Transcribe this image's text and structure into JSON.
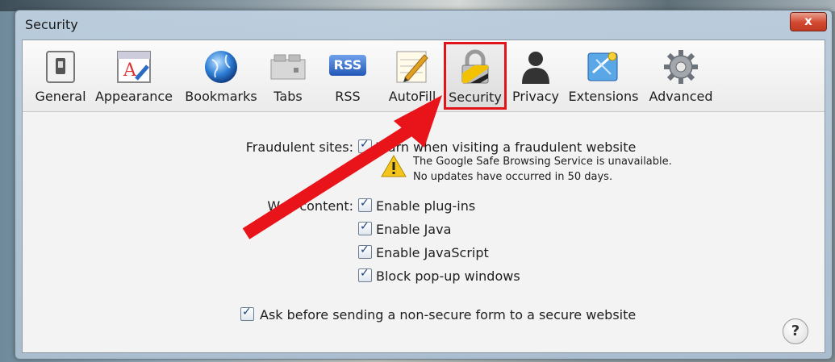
{
  "window": {
    "title": "Security",
    "close_glyph": "x"
  },
  "toolbar": {
    "items": [
      {
        "label": "General",
        "icon": "general-switch-icon"
      },
      {
        "label": "Appearance",
        "icon": "appearance-icon"
      },
      {
        "label": "Bookmarks",
        "icon": "globe-icon"
      },
      {
        "label": "Tabs",
        "icon": "tabs-icon"
      },
      {
        "label": "RSS",
        "icon": "rss-icon",
        "icon_text": "RSS"
      },
      {
        "label": "AutoFill",
        "icon": "autofill-pencil-icon"
      },
      {
        "label": "Security",
        "icon": "padlock-icon",
        "selected": true
      },
      {
        "label": "Privacy",
        "icon": "person-silhouette-icon"
      },
      {
        "label": "Extensions",
        "icon": "puzzle-icon"
      },
      {
        "label": "Advanced",
        "icon": "gear-icon"
      }
    ]
  },
  "fraud": {
    "label": "Fraudulent sites:",
    "checkbox_text": "Warn when visiting a fraudulent website",
    "checked": true,
    "warning_line1": "The Google Safe Browsing Service is unavailable.",
    "warning_line2": "No updates have occurred in 50 days."
  },
  "web_content": {
    "label": "Web content:",
    "options": [
      {
        "text": "Enable plug-ins",
        "checked": true
      },
      {
        "text": "Enable Java",
        "checked": true
      },
      {
        "text": "Enable JavaScript",
        "checked": true
      },
      {
        "text": "Block pop-up windows",
        "checked": true
      }
    ]
  },
  "ask_secure": {
    "text": "Ask before sending a non-secure form to a secure website",
    "checked": true
  },
  "help": {
    "glyph": "?"
  },
  "colors": {
    "highlight": "#e0141a",
    "arrow": "#e8141a"
  }
}
